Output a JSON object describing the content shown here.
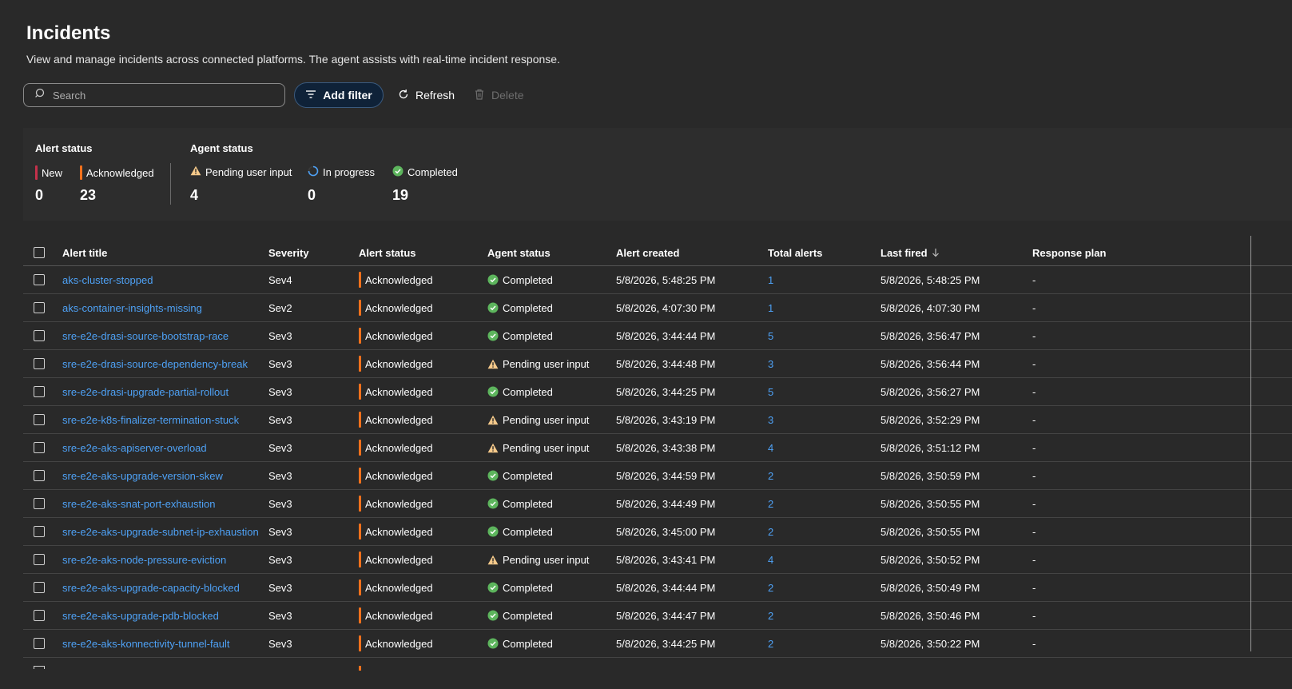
{
  "page": {
    "title": "Incidents",
    "subtitle": "View and manage incidents across connected platforms. The agent assists with real-time incident response."
  },
  "toolbar": {
    "search_placeholder": "Search",
    "add_filter_label": "Add filter",
    "refresh_label": "Refresh",
    "delete_label": "Delete"
  },
  "summary": {
    "alert_status": {
      "heading": "Alert status",
      "new_label": "New",
      "new_count": "0",
      "ack_label": "Acknowledged",
      "ack_count": "23"
    },
    "agent_status": {
      "heading": "Agent status",
      "pending_label": "Pending user input",
      "pending_count": "4",
      "progress_label": "In progress",
      "progress_count": "0",
      "completed_label": "Completed",
      "completed_count": "19"
    }
  },
  "table": {
    "columns": {
      "title": "Alert title",
      "severity": "Severity",
      "alert_status": "Alert status",
      "agent_status": "Agent status",
      "created": "Alert created",
      "total": "Total alerts",
      "last_fired": "Last fired",
      "plan": "Response plan"
    },
    "rows": [
      {
        "title": "aks-cluster-stopped",
        "severity": "Sev4",
        "alert_status": "Acknowledged",
        "agent_status": "Completed",
        "created": "5/8/2026, 5:48:25 PM",
        "total": "1",
        "last_fired": "5/8/2026, 5:48:25 PM",
        "plan": "-"
      },
      {
        "title": "aks-container-insights-missing",
        "severity": "Sev2",
        "alert_status": "Acknowledged",
        "agent_status": "Completed",
        "created": "5/8/2026, 4:07:30 PM",
        "total": "1",
        "last_fired": "5/8/2026, 4:07:30 PM",
        "plan": "-"
      },
      {
        "title": "sre-e2e-drasi-source-bootstrap-race",
        "severity": "Sev3",
        "alert_status": "Acknowledged",
        "agent_status": "Completed",
        "created": "5/8/2026, 3:44:44 PM",
        "total": "5",
        "last_fired": "5/8/2026, 3:56:47 PM",
        "plan": "-"
      },
      {
        "title": "sre-e2e-drasi-source-dependency-break",
        "severity": "Sev3",
        "alert_status": "Acknowledged",
        "agent_status": "Pending user input",
        "created": "5/8/2026, 3:44:48 PM",
        "total": "3",
        "last_fired": "5/8/2026, 3:56:44 PM",
        "plan": "-"
      },
      {
        "title": "sre-e2e-drasi-upgrade-partial-rollout",
        "severity": "Sev3",
        "alert_status": "Acknowledged",
        "agent_status": "Completed",
        "created": "5/8/2026, 3:44:25 PM",
        "total": "5",
        "last_fired": "5/8/2026, 3:56:27 PM",
        "plan": "-"
      },
      {
        "title": "sre-e2e-k8s-finalizer-termination-stuck",
        "severity": "Sev3",
        "alert_status": "Acknowledged",
        "agent_status": "Pending user input",
        "created": "5/8/2026, 3:43:19 PM",
        "total": "3",
        "last_fired": "5/8/2026, 3:52:29 PM",
        "plan": "-"
      },
      {
        "title": "sre-e2e-aks-apiserver-overload",
        "severity": "Sev3",
        "alert_status": "Acknowledged",
        "agent_status": "Pending user input",
        "created": "5/8/2026, 3:43:38 PM",
        "total": "4",
        "last_fired": "5/8/2026, 3:51:12 PM",
        "plan": "-"
      },
      {
        "title": "sre-e2e-aks-upgrade-version-skew",
        "severity": "Sev3",
        "alert_status": "Acknowledged",
        "agent_status": "Completed",
        "created": "5/8/2026, 3:44:59 PM",
        "total": "2",
        "last_fired": "5/8/2026, 3:50:59 PM",
        "plan": "-"
      },
      {
        "title": "sre-e2e-aks-snat-port-exhaustion",
        "severity": "Sev3",
        "alert_status": "Acknowledged",
        "agent_status": "Completed",
        "created": "5/8/2026, 3:44:49 PM",
        "total": "2",
        "last_fired": "5/8/2026, 3:50:55 PM",
        "plan": "-"
      },
      {
        "title": "sre-e2e-aks-upgrade-subnet-ip-exhaustion",
        "severity": "Sev3",
        "alert_status": "Acknowledged",
        "agent_status": "Completed",
        "created": "5/8/2026, 3:45:00 PM",
        "total": "2",
        "last_fired": "5/8/2026, 3:50:55 PM",
        "plan": "-"
      },
      {
        "title": "sre-e2e-aks-node-pressure-eviction",
        "severity": "Sev3",
        "alert_status": "Acknowledged",
        "agent_status": "Pending user input",
        "created": "5/8/2026, 3:43:41 PM",
        "total": "4",
        "last_fired": "5/8/2026, 3:50:52 PM",
        "plan": "-"
      },
      {
        "title": "sre-e2e-aks-upgrade-capacity-blocked",
        "severity": "Sev3",
        "alert_status": "Acknowledged",
        "agent_status": "Completed",
        "created": "5/8/2026, 3:44:44 PM",
        "total": "2",
        "last_fired": "5/8/2026, 3:50:49 PM",
        "plan": "-"
      },
      {
        "title": "sre-e2e-aks-upgrade-pdb-blocked",
        "severity": "Sev3",
        "alert_status": "Acknowledged",
        "agent_status": "Completed",
        "created": "5/8/2026, 3:44:47 PM",
        "total": "2",
        "last_fired": "5/8/2026, 3:50:46 PM",
        "plan": "-"
      },
      {
        "title": "sre-e2e-aks-konnectivity-tunnel-fault",
        "severity": "Sev3",
        "alert_status": "Acknowledged",
        "agent_status": "Completed",
        "created": "5/8/2026, 3:44:25 PM",
        "total": "2",
        "last_fired": "5/8/2026, 3:50:22 PM",
        "plan": "-"
      }
    ]
  },
  "colors": {
    "background": "#292929",
    "link": "#4ea1f5",
    "new_bar": "#c4314b",
    "ack_bar": "#f2711c",
    "completed": "#5db55d",
    "pending": "#f5c98a",
    "progress": "#4ea1f5"
  }
}
